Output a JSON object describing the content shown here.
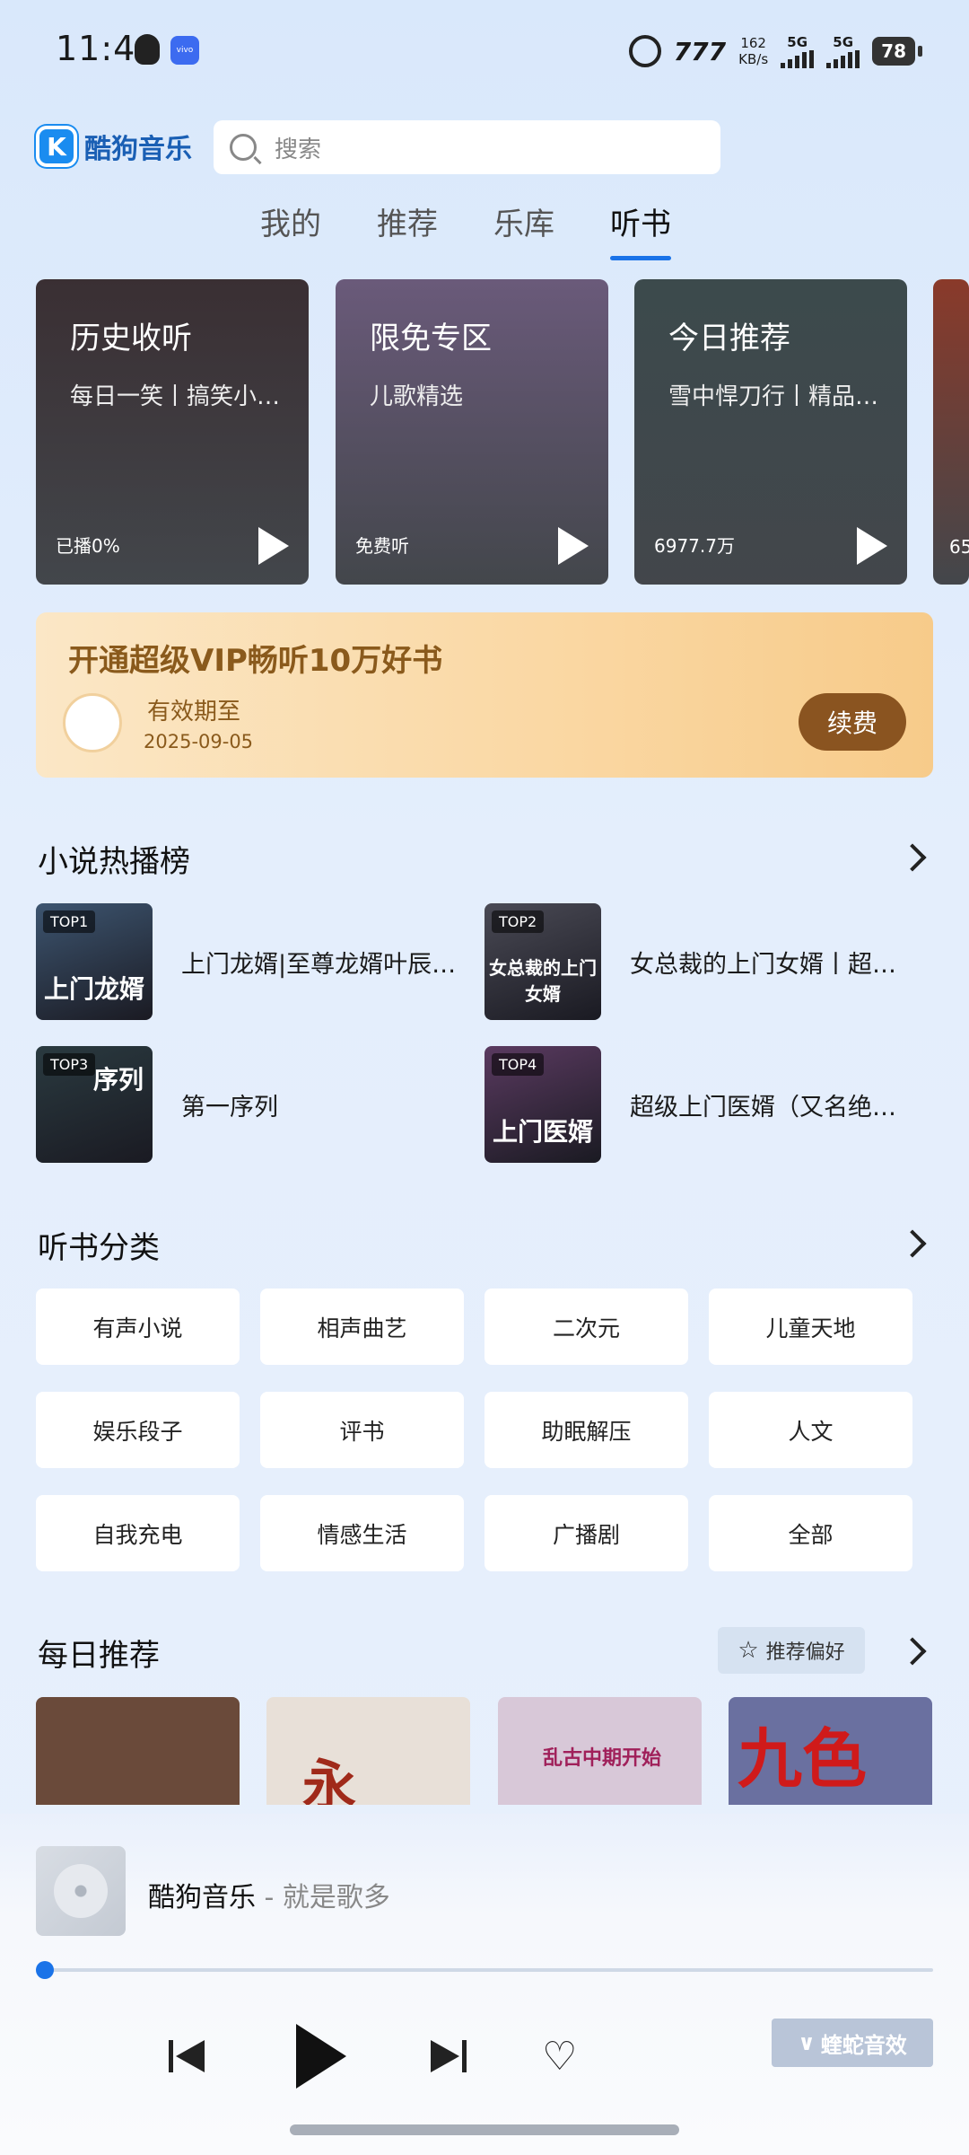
{
  "status": {
    "time": "11:49",
    "speed": "162\nKB/s",
    "net1": "5G",
    "net2": "5G",
    "battery": "78",
    "nfc": "777",
    "vivo": "vivo"
  },
  "header": {
    "logo_text": "酷狗音乐",
    "logo_letter": "K",
    "search_placeholder": "搜索"
  },
  "tabs": [
    {
      "label": "我的",
      "active": false
    },
    {
      "label": "推荐",
      "active": false
    },
    {
      "label": "乐库",
      "active": false
    },
    {
      "label": "听书",
      "active": true
    }
  ],
  "feature_cards": [
    {
      "title": "历史收听",
      "subtitle": "每日一笑丨搞笑小品合集",
      "footer": "已播0%",
      "bg": "#3a2f33"
    },
    {
      "title": "限免专区",
      "subtitle": "儿歌精选",
      "footer": "免费听",
      "bg": "#6a5a7a"
    },
    {
      "title": "今日推荐",
      "subtitle": "雪中悍刀行丨精品有声剧",
      "footer": "6977.7万",
      "bg": "#3c4a4c"
    },
    {
      "title": "",
      "subtitle": "",
      "footer": "65",
      "bg": "#8a3a2a"
    }
  ],
  "vip": {
    "title": "开通超级VIP畅听10万好书",
    "label": "有效期至",
    "date": "2025-09-05",
    "button": "续费"
  },
  "ranking": {
    "title": "小说热播榜",
    "items": [
      {
        "badge": "TOP1",
        "cover_text": "上门龙婿",
        "title": "上门龙婿|至尊龙婿叶辰…",
        "bg": "#3d5570"
      },
      {
        "badge": "TOP2",
        "cover_text": "女总裁的上门女婿",
        "title": "女总裁的上门女婿丨超…",
        "bg": "#4a4a55"
      },
      {
        "badge": "TOP3",
        "cover_text": "序列",
        "title": "第一序列",
        "bg": "#2a3a40"
      },
      {
        "badge": "TOP4",
        "cover_text": "上门医婿",
        "title": "超级上门医婿（又名绝…",
        "bg": "#5a3a60"
      }
    ]
  },
  "categories": {
    "title": "听书分类",
    "items": [
      "有声小说",
      "相声曲艺",
      "二次元",
      "儿童天地",
      "娱乐段子",
      "评书",
      "助眠解压",
      "人文",
      "自我充电",
      "情感生活",
      "广播剧",
      "全部"
    ]
  },
  "daily": {
    "title": "每日推荐",
    "pref_button": "推荐偏好",
    "covers": [
      {
        "bg": "#6a4a3a",
        "text": ""
      },
      {
        "bg": "#e8e0d8",
        "text": "永"
      },
      {
        "bg": "#d8c8d8",
        "text": "乱古中期开始"
      },
      {
        "bg": "#6a70a0",
        "text": "九色"
      }
    ]
  },
  "player": {
    "title": "酷狗音乐",
    "subtitle": " - 就是歌多",
    "progress": 0.0,
    "effect_button": "蝰蛇音效"
  }
}
